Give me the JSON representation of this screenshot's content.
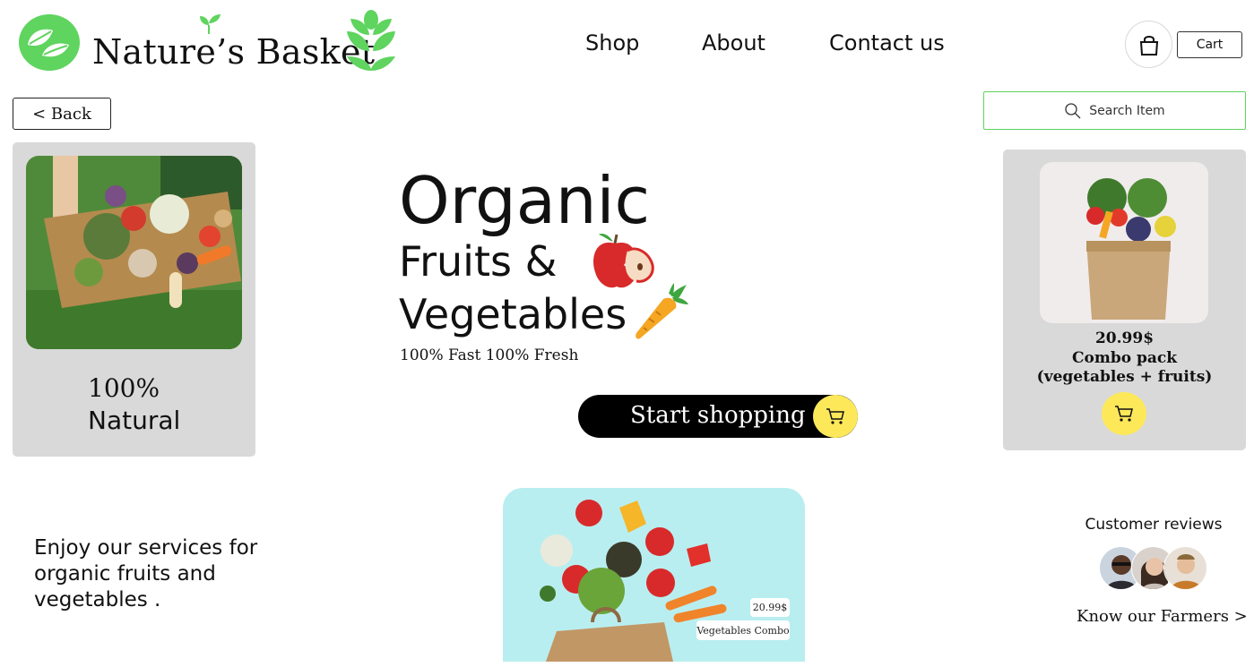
{
  "header": {
    "brand": "Nature’s Basket",
    "nav": [
      {
        "label": "Shop"
      },
      {
        "label": "About"
      },
      {
        "label": "Contact us"
      }
    ],
    "cart_label": "Cart"
  },
  "toolbar": {
    "back_label": "< Back",
    "search_placeholder": "Search Item"
  },
  "left_card": {
    "percent": "100%",
    "label": "Natural"
  },
  "hero": {
    "line1": "Organic",
    "line2": "Fruits &",
    "line3": "Vegetables",
    "subtitle": "100% Fast 100% Fresh",
    "cta_label": "Start shopping"
  },
  "right_card": {
    "price": "20.99$",
    "name_line1": "Combo pack",
    "name_line2": "(vegetables + fruits)"
  },
  "bottom": {
    "enjoy_text": "Enjoy our services for organic fruits and vegetables .",
    "tag_price": "20.99$",
    "tag_name": "Vegetables Combo"
  },
  "reviews": {
    "title": "Customer reviews",
    "farmers_link": "Know our Farmers >"
  },
  "colors": {
    "brand_green": "#5fd45f",
    "accent_yellow": "#fde85a",
    "card_gray": "#d9d9d9",
    "cta_black": "#000000"
  },
  "icons": [
    "leaf-logo-icon",
    "sprout-icon",
    "wheat-icon",
    "shopping-bag-icon",
    "search-icon",
    "apple-icon",
    "carrot-icon",
    "cart-icon"
  ]
}
